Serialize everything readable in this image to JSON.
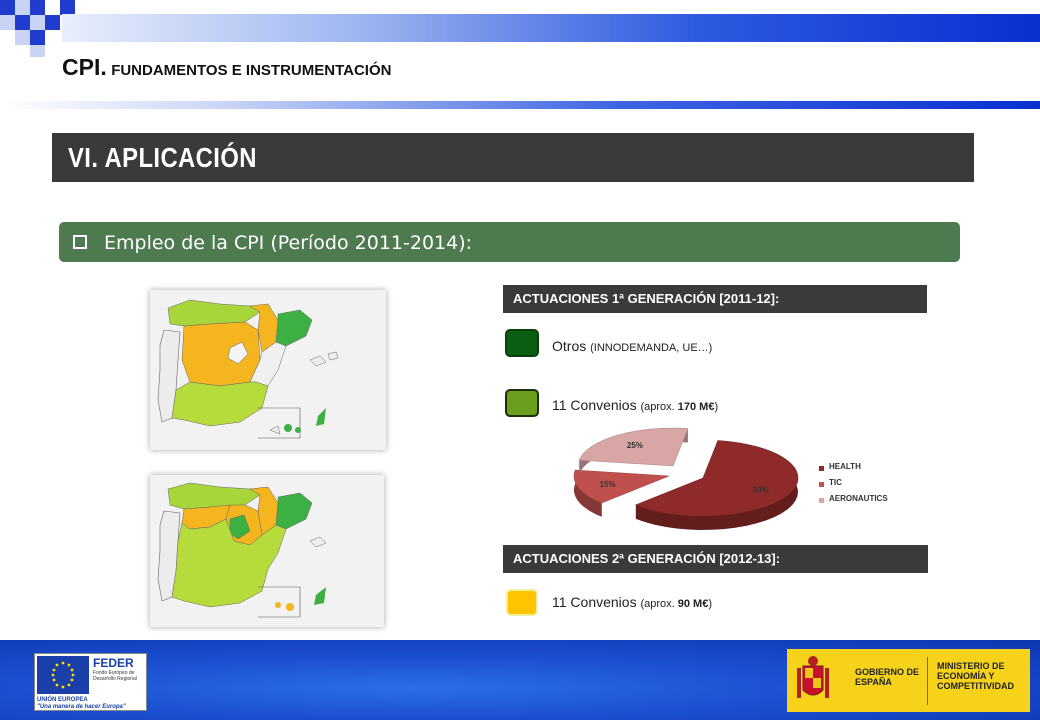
{
  "header": {
    "title_big": "CPI.",
    "title_small": "FUNDAMENTOS E INSTRUMENTACIÓN"
  },
  "section": {
    "title": "VI.   APLICACIÓN"
  },
  "subtitle": {
    "label": "Empleo de la CPI (Período 2011-2014):"
  },
  "generation1": {
    "title": "ACTUACIONES 1ª GENERACIÓN [2011-12]:",
    "items": [
      {
        "label": "Otros",
        "detail": "(INNODEMANDA, UE…)",
        "color": "#0a5e12"
      },
      {
        "label": "11 Convenios",
        "detail_pre": "(aprox. ",
        "amount": "170 M€",
        "detail_post": ")",
        "color": "#6b9e1c"
      }
    ]
  },
  "generation2": {
    "title": "ACTUACIONES 2ª GENERACIÓN [2012-13]:",
    "items": [
      {
        "label": "11 Convenios",
        "detail_pre": "(aprox. ",
        "amount": "90 M€",
        "detail_post": ")",
        "color": "#ffc400"
      }
    ]
  },
  "chart_data": {
    "type": "pie",
    "categories": [
      "HEALTH",
      "TIC",
      "AERONAUTICS"
    ],
    "values": [
      60,
      15,
      25
    ],
    "value_labels": [
      "60%",
      "15%",
      "25%"
    ],
    "colors": [
      "#8f2a2a",
      "#c0504d",
      "#d9a6a6"
    ],
    "legend": "right"
  },
  "footer": {
    "feder_title": "FEDER",
    "feder_sub": "Fondo Europeo de Desarrollo Regional",
    "feder_ue": "UNIÓN EUROPEA",
    "feder_motto": "\"Una manera de hacer Europa\"",
    "gob_left": "GOBIERNO DE ESPAÑA",
    "gob_right": "MINISTERIO DE ECONOMÍA Y COMPETITIVIDAD"
  }
}
